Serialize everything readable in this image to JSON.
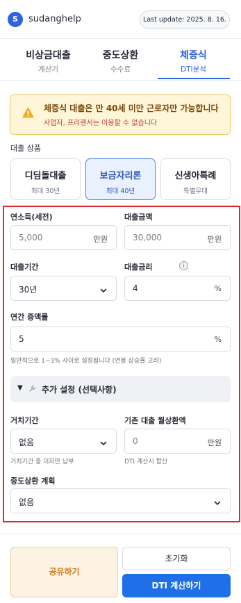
{
  "header": {
    "logo_letter": "S",
    "brand": "sudanghelp",
    "last_update": "Last update: 2025. 8. 16."
  },
  "tabs": [
    {
      "title": "비상금대출",
      "subtitle": "계산기"
    },
    {
      "title": "중도상환",
      "subtitle": "수수료"
    },
    {
      "title": "체증식",
      "subtitle": "DTI분석"
    }
  ],
  "active_tab": "체증식",
  "warning": {
    "title": "체증식 대출은 만 40세 미만 근로자만 가능합니다",
    "subtitle": "사업자, 프리랜서는 이용할 수 없습니다"
  },
  "product_section": {
    "label": "대출 상품",
    "products": [
      {
        "name": "디딤돌대출",
        "limit": "최대 30년"
      },
      {
        "name": "보금자리론",
        "limit": "최대 40년"
      },
      {
        "name": "신생아특례",
        "limit": "특별우대"
      }
    ],
    "selected": "보금자리론"
  },
  "form": {
    "annual_income": {
      "label": "연소득(세전)",
      "placeholder": "5,000",
      "unit": "만원"
    },
    "loan_amount": {
      "label": "대출금액",
      "placeholder": "30,000",
      "unit": "만원"
    },
    "loan_term": {
      "label": "대출기간",
      "value": "30년"
    },
    "loan_rate": {
      "label": "대출금리",
      "info": "i",
      "value": "4",
      "unit": "%"
    },
    "annual_increase": {
      "label": "연간 증액률",
      "value": "5",
      "unit": "%",
      "hint": "일반적으로 1~3% 사이로 설정됩니다 (연봉 상승률 고려)"
    },
    "advanced": {
      "arrow": "▼",
      "label": "추가 설정 (선택사항)"
    },
    "grace_period": {
      "label": "거치기간",
      "value": "없음",
      "hint": "거치기간 중 이자만 납부"
    },
    "existing_payment": {
      "label": "기존 대출 월상환액",
      "placeholder": "0",
      "unit": "만원",
      "hint": "DTI 계산시 합산"
    },
    "prepayment_plan": {
      "label": "중도상환 계획",
      "value": "없음"
    }
  },
  "actions": {
    "share": "공유하기",
    "reset": "초기화",
    "calculate": "DTI 계산하기"
  },
  "colors": {
    "accent": "#2f63e0",
    "primary_button": "#1f6fe8",
    "warning_bg": "#fff6d9",
    "warning_text": "#c43b2a",
    "highlight_border": "#e0262a",
    "share_bg": "#fdf3e4",
    "share_text": "#d07a1a"
  }
}
